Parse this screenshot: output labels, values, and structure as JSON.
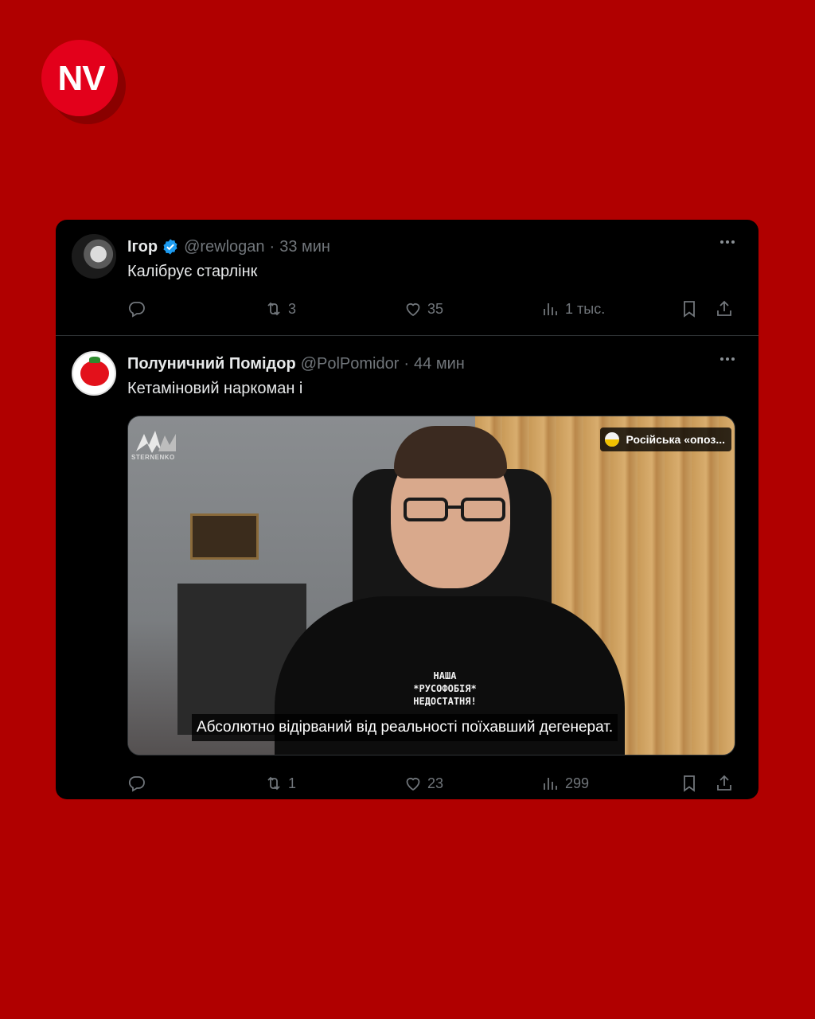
{
  "brand": {
    "logo_text": "NV",
    "background": "#b00000",
    "logo_color": "#e3001b"
  },
  "tweets": [
    {
      "name": "Ігор",
      "verified": true,
      "handle": "@rewlogan",
      "time": "33 мин",
      "text": "Калібрує старлінк",
      "actions": {
        "reply": "",
        "retweet": "3",
        "like": "35",
        "views": "1 тыс."
      }
    },
    {
      "name": "Полуничний Помідор",
      "verified": false,
      "handle": "@PolPomidor",
      "time": "44 мин",
      "text": "Кетаміновий наркоман і",
      "media": {
        "channel_logo_text": "STERNENKO",
        "badge_text": "Російська «опоз...",
        "shirt_text": [
          "НАША",
          "*РУСОФОБІЯ*",
          "НЕДОСТАТНЯ!"
        ],
        "subtitle": "Абсолютно відірваний від реальності поїхавший дегенерат."
      },
      "actions": {
        "reply": "",
        "retweet": "1",
        "like": "23",
        "views": "299"
      }
    }
  ],
  "separator": "·",
  "colors": {
    "card_bg": "#000000",
    "text": "#e7e9ea",
    "muted": "#71767b",
    "verified": "#1d9bf0",
    "border": "#2f3336"
  }
}
